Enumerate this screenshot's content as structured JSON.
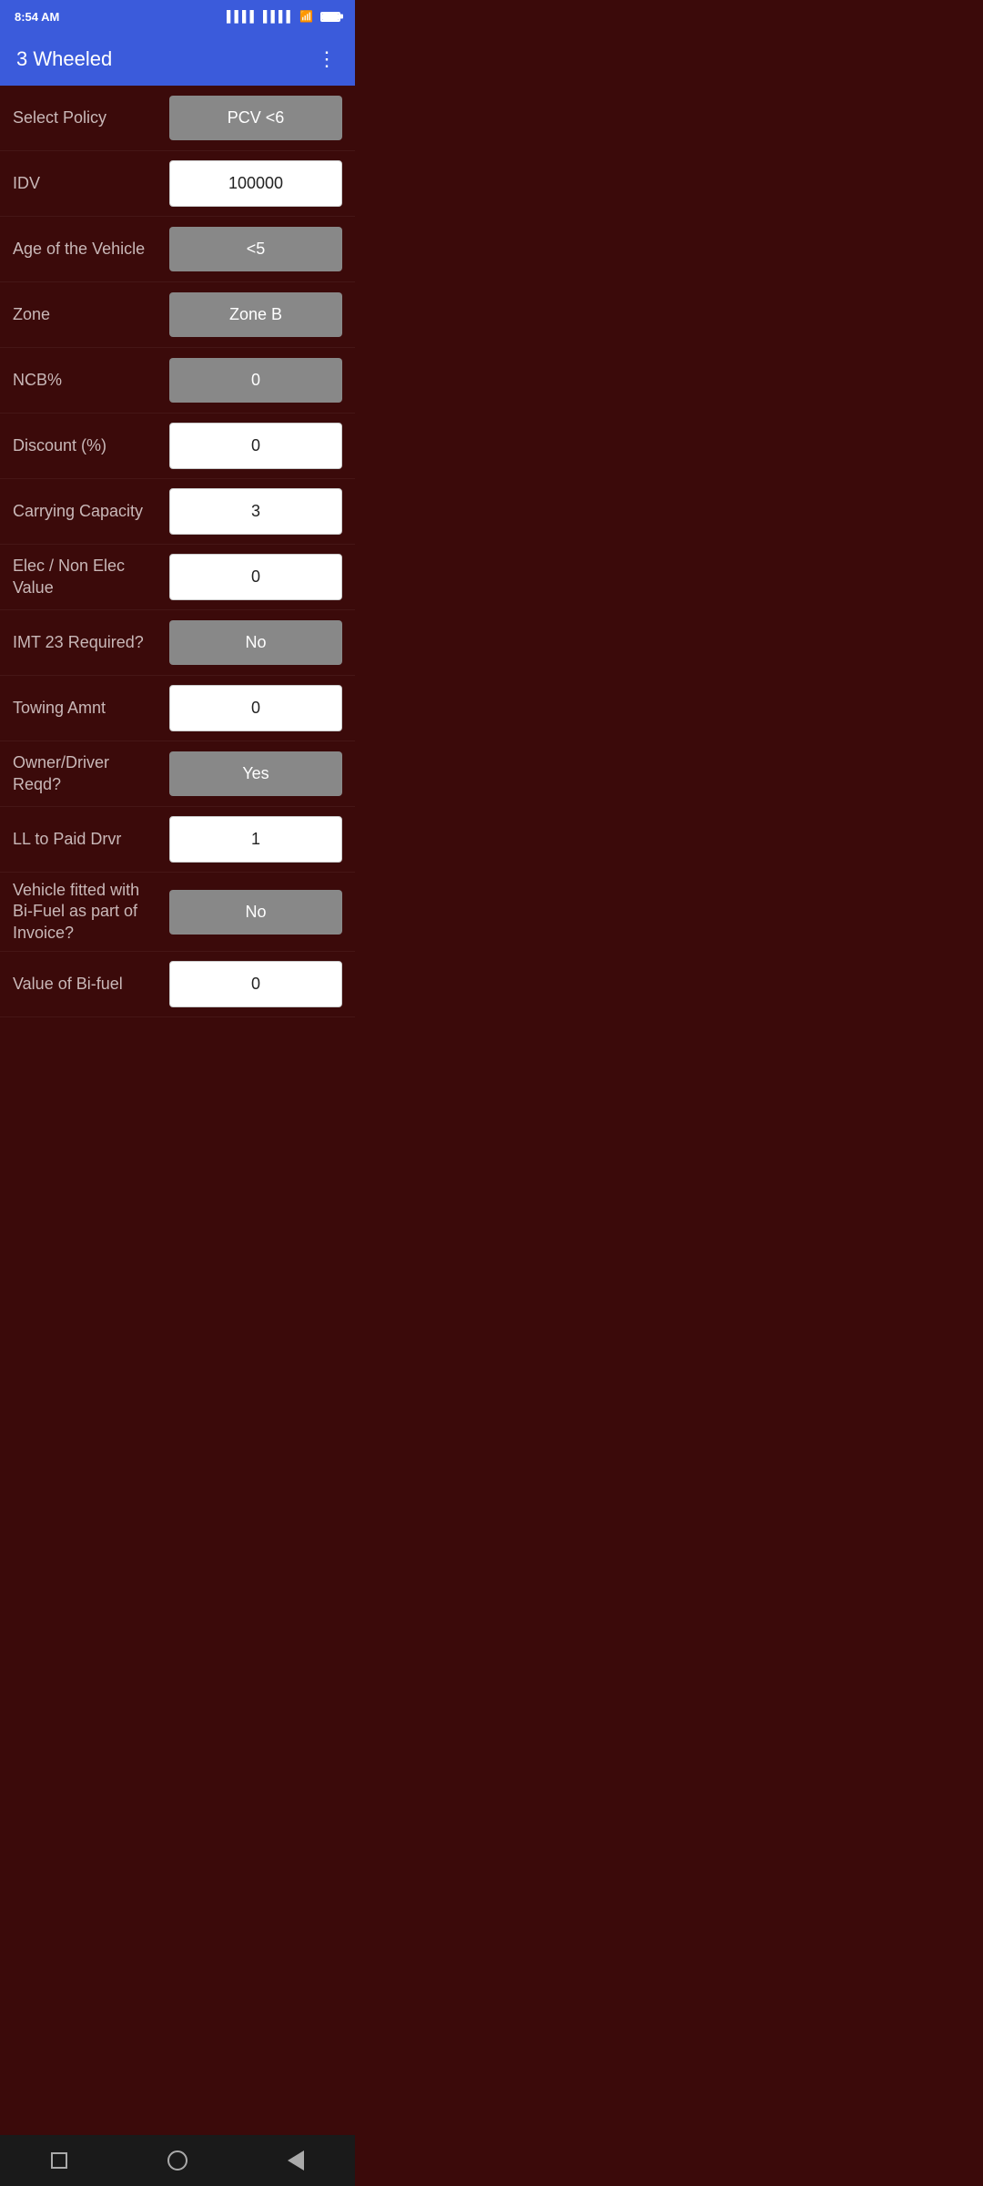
{
  "statusBar": {
    "time": "8:54 AM",
    "battery": "100"
  },
  "appBar": {
    "title": "3 Wheeled",
    "menuIcon": "⋮"
  },
  "form": {
    "rows": [
      {
        "label": "Select Policy",
        "value": "PCV <6",
        "type": "dropdown"
      },
      {
        "label": "IDV",
        "value": "100000",
        "type": "input"
      },
      {
        "label": "Age of the Vehicle",
        "value": "<5",
        "type": "dropdown"
      },
      {
        "label": "Zone",
        "value": "Zone B",
        "type": "dropdown"
      },
      {
        "label": "NCB%",
        "value": "0",
        "type": "dropdown"
      },
      {
        "label": "Discount (%)",
        "value": "0",
        "type": "input"
      },
      {
        "label": "Carrying Capacity",
        "value": "3",
        "type": "input"
      },
      {
        "label": "Elec / Non Elec Value",
        "value": "0",
        "type": "input"
      },
      {
        "label": "IMT 23 Required?",
        "value": "No",
        "type": "dropdown"
      },
      {
        "label": "Towing Amnt",
        "value": "0",
        "type": "input"
      },
      {
        "label": "Owner/Driver Reqd?",
        "value": "Yes",
        "type": "dropdown"
      },
      {
        "label": "LL to Paid Drvr",
        "value": "1",
        "type": "input"
      },
      {
        "label": "Vehicle fitted with Bi-Fuel as part of Invoice?",
        "value": "No",
        "type": "dropdown"
      },
      {
        "label": "Value of Bi-fuel",
        "value": "0",
        "type": "input"
      }
    ]
  },
  "bottomNav": {
    "square": "square-icon",
    "circle": "home-icon",
    "back": "back-icon"
  }
}
